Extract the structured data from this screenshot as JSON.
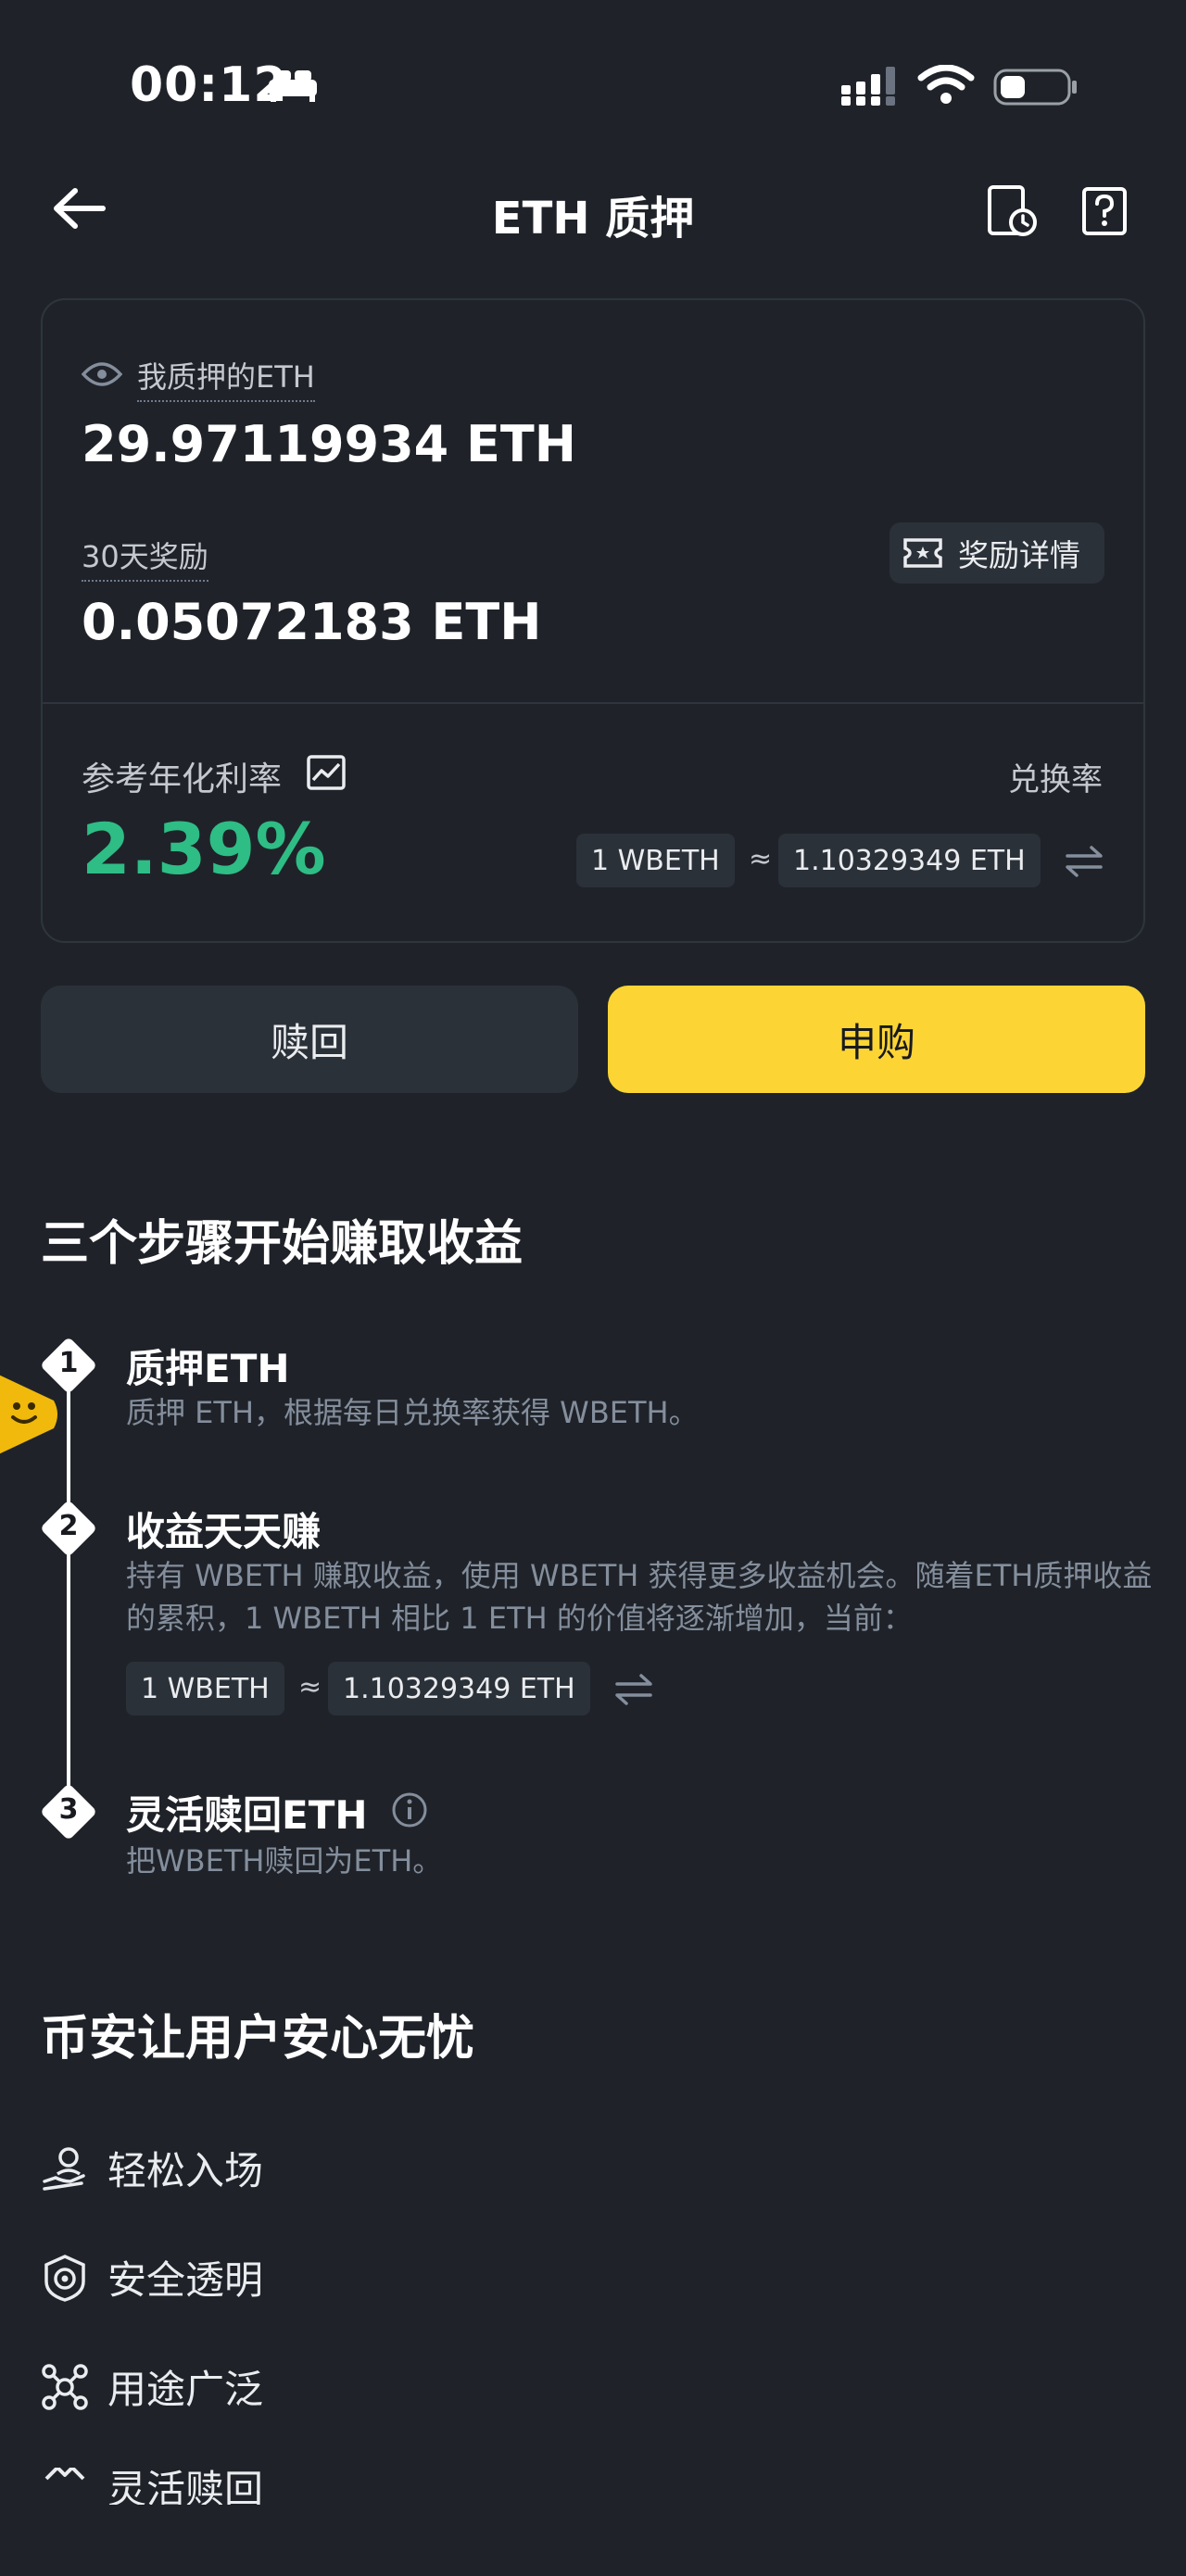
{
  "status_bar": {
    "time": "00:12"
  },
  "nav": {
    "title": "ETH 质押"
  },
  "summary": {
    "staked_label": "我质押的ETH",
    "staked_value": "29.97119934 ETH",
    "reward_label": "30天奖励",
    "reward_value": "0.05072183 ETH",
    "reward_detail_label": "奖励详情",
    "apr_label": "参考年化利率",
    "apr_value": "2.39%",
    "rate_label": "兑换率",
    "rate_left": "1 WBETH",
    "rate_approx": "≈",
    "rate_right": "1.10329349 ETH"
  },
  "actions": {
    "redeem_label": "赎回",
    "subscribe_label": "申购"
  },
  "steps": {
    "title": "三个步骤开始赚取收益",
    "items": [
      {
        "num": "1",
        "title": "质押ETH",
        "desc": "质押 ETH，根据每日兑换率获得 WBETH。"
      },
      {
        "num": "2",
        "title": "收益天天赚",
        "desc": "持有 WBETH 赚取收益，使用 WBETH 获得更多收益机会。随着ETH质押收益的累积，1 WBETH 相比 1 ETH 的价值将逐渐增加，当前："
      },
      {
        "num": "3",
        "title": "灵活赎回ETH",
        "desc": "把WBETH赎回为ETH。"
      }
    ],
    "rate_left": "1 WBETH",
    "rate_approx": "≈",
    "rate_right": "1.10329349 ETH"
  },
  "safety": {
    "title": "币安让用户安心无忧",
    "features": [
      {
        "label": "轻松入场",
        "icon": "hand-user-icon"
      },
      {
        "label": "安全透明",
        "icon": "shield-target-icon"
      },
      {
        "label": "用途广泛",
        "icon": "network-icon"
      },
      {
        "label": "灵活赎回",
        "icon": "redeem-icon"
      }
    ]
  },
  "colors": {
    "accent": "#fcd535",
    "positive": "#2ebd85",
    "background": "#1f2329",
    "surface": "#2b3139"
  }
}
